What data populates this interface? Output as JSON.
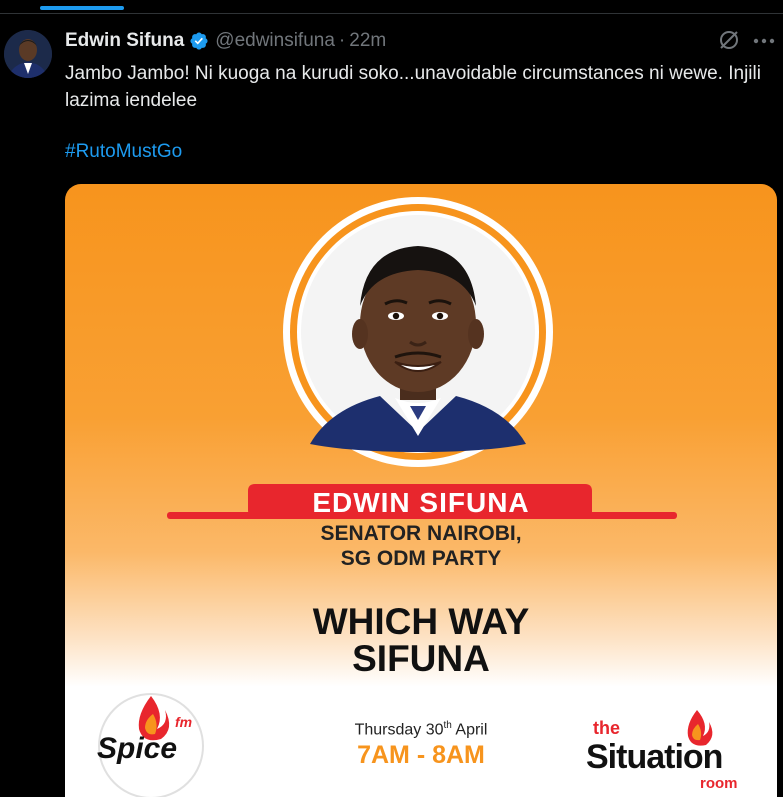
{
  "tweet": {
    "author_name": "Edwin Sifuna",
    "handle": "@edwinsifuna",
    "separator": "·",
    "time": "22m",
    "text": "Jambo Jambo! Ni kuoga na kurudi soko...unavoidable circumstances ni wewe. Injili lazima iendelee",
    "hashtag": "#RutoMustGo"
  },
  "icons": {
    "verified": "verified-badge-icon",
    "grok": "grok-icon",
    "more": "more-options-icon"
  },
  "poster": {
    "guest_name": "EDWIN SIFUNA",
    "guest_title_line1": "SENATOR NAIROBI,",
    "guest_title_line2": "SG ODM PARTY",
    "show_title_line1": "WHICH WAY",
    "show_title_line2": "SIFUNA",
    "date_day": "Thursday 30",
    "date_suffix": "th",
    "date_month": " April",
    "time": "7AM - 8AM",
    "left_logo": {
      "brand": "Spice",
      "tag": "fm"
    },
    "right_logo": {
      "top": "the",
      "main": "Situation",
      "bottom": "room"
    }
  },
  "colors": {
    "link": "#1d9bf0",
    "poster_orange": "#f7941d",
    "name_banner_red": "#e8262d"
  }
}
